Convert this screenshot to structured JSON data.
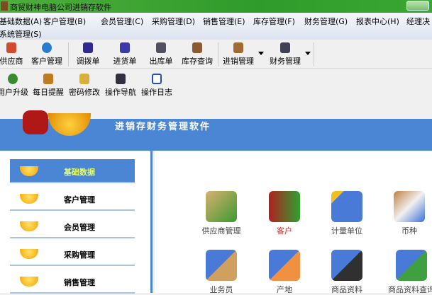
{
  "window": {
    "title": "商贸财神电脑公司进销存软件"
  },
  "menu": [
    "基础数据(A)",
    "客户管理(B)",
    "会员管理(C)",
    "采购管理(D)",
    "销售管理(E)",
    "库存管理(F)",
    "财务管理(G)",
    "报表中心(H)",
    "经理决",
    "系统管理(S)"
  ],
  "toolbar1": [
    "供应商",
    "客户管理",
    "调拨单",
    "进货单",
    "出库单",
    "库存查询",
    "进销管理",
    "财务管理"
  ],
  "toolbar2": [
    "用户升级",
    "每日提醒",
    "密码修改",
    "操作导航",
    "操作日志"
  ],
  "banner": {
    "title": "进销存财务管理软件"
  },
  "sidebar": [
    {
      "label": "基础数据",
      "active": true
    },
    {
      "label": "客户管理"
    },
    {
      "label": "会员管理"
    },
    {
      "label": "采购管理"
    },
    {
      "label": "销售管理"
    }
  ],
  "grid": [
    {
      "label": "供应商管理"
    },
    {
      "label": "客户",
      "highlight": "#e02020"
    },
    {
      "label": "计量单位"
    },
    {
      "label": "币种"
    },
    {
      "label": "业务员"
    },
    {
      "label": "产地"
    },
    {
      "label": "商品资料"
    },
    {
      "label": "商品资料查询"
    }
  ],
  "colors": {
    "accent": "#4a86d4",
    "title_bar": "#2f9b2a"
  }
}
